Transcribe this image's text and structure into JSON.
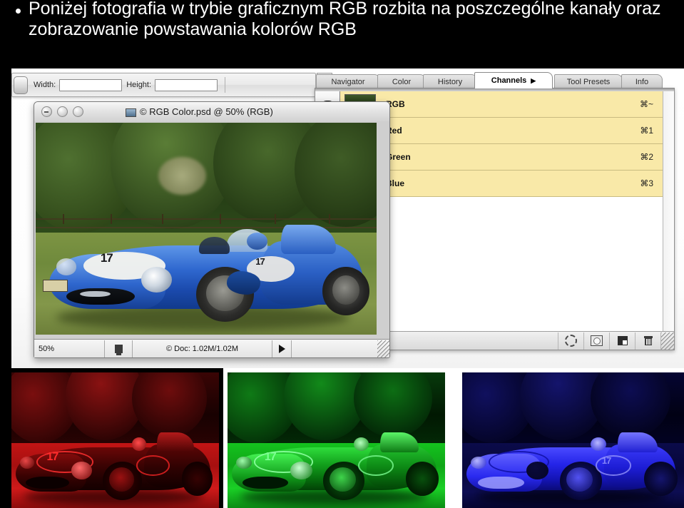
{
  "slide": {
    "bullet": "•",
    "title": "Poniżej fotografia w trybie graficznym RGB rozbita na poszczególne kanały oraz zobrazowanie powstawania kolorów RGB"
  },
  "options_bar": {
    "tool_icon": "marquee-tool-icon",
    "width_label": "Width:",
    "width_value": "",
    "width_placeholder": "",
    "height_label": "Height:",
    "height_value": "",
    "height_placeholder": "",
    "palette_well": "palette-well-icon"
  },
  "palette": {
    "tabs": [
      {
        "label": "Navigator",
        "active": false
      },
      {
        "label": "Color",
        "active": false
      },
      {
        "label": "History",
        "active": false
      },
      {
        "label": "Channels",
        "active": true,
        "menu_arrow": "▶"
      },
      {
        "label": "Tool Presets",
        "active": false
      },
      {
        "label": "Info",
        "active": false
      }
    ],
    "channels": [
      {
        "name": "RGB",
        "shortcut": "⌘~",
        "visible": true,
        "selected": true,
        "thumb": "composite"
      },
      {
        "name": "Red",
        "shortcut": "⌘1",
        "visible": true,
        "selected": true,
        "thumb": "red"
      },
      {
        "name": "Green",
        "shortcut": "⌘2",
        "visible": true,
        "selected": true,
        "thumb": "green"
      },
      {
        "name": "Blue",
        "shortcut": "⌘3",
        "visible": true,
        "selected": true,
        "thumb": "blue"
      }
    ],
    "footer_buttons": [
      {
        "name": "load-channel-as-selection",
        "icon": "dashed-circle-icon"
      },
      {
        "name": "save-selection-as-channel",
        "icon": "circle-in-square-icon"
      },
      {
        "name": "create-new-channel",
        "icon": "new-page-icon"
      },
      {
        "name": "delete-channel",
        "icon": "trash-icon"
      }
    ],
    "highlight_color": "#f9e9a8"
  },
  "document": {
    "window_controls": [
      "close",
      "minimize",
      "zoom"
    ],
    "title": "© RGB Color.psd @ 50% (RGB)",
    "status": {
      "zoom": "50%",
      "doc_icon": "document-size-icon",
      "doc_info": "© Doc: 1.02M/1.02M",
      "play": "▶"
    }
  },
  "channel_strip": [
    {
      "name": "red-channel-image",
      "label": "Red channel",
      "color": "#ff0000"
    },
    {
      "name": "green-channel-image",
      "label": "Green channel",
      "color": "#00c814"
    },
    {
      "name": "blue-channel-image",
      "label": "Blue channel",
      "color": "#1414ff"
    }
  ],
  "colors": {
    "slide_bg": "#000000",
    "ui_bg": "#ffffff",
    "panel_highlight": "#f9e9a8",
    "car_blue": "#2b62c4"
  }
}
